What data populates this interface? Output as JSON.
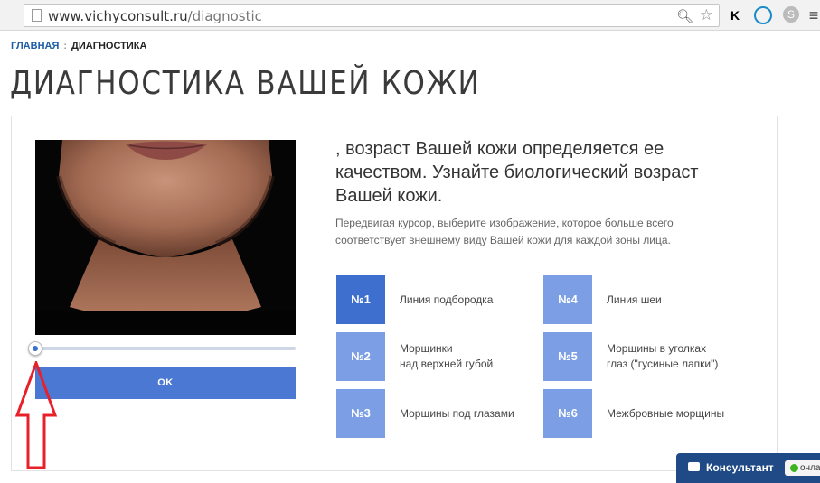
{
  "browser": {
    "url_domain": "www.vichyconsult.ru",
    "url_path": "/diagnostic",
    "extensions": [
      {
        "name": "k-extension-icon",
        "glyph": "K"
      },
      {
        "name": "a-extension-icon",
        "glyph": ""
      },
      {
        "name": "skype-icon",
        "glyph": "S"
      },
      {
        "name": "menu-icon",
        "glyph": "≡"
      }
    ]
  },
  "breadcrumb": {
    "home": "ГЛАВНАЯ",
    "separator": ":",
    "current": "ДИАГНОСТИКА"
  },
  "page_title": "ДИАГНОСТИКА ВАШЕЙ КОЖИ",
  "diagnostic": {
    "lead": ", возраст Вашей кожи определяется ее качеством. Узнайте биологический возраст Вашей кожи.",
    "instruction": "Передвигая курсор, выберите изображение, которое больше всего соответствует внешнему виду Вашей кожи для каждой зоны лица.",
    "slider_position_fraction": 0.0,
    "ok_label": "OK",
    "zones": [
      {
        "number": "№1",
        "label": "Линия подбородка",
        "active": true
      },
      {
        "number": "№2",
        "label": "Морщинки\nнад верхней губой",
        "active": false
      },
      {
        "number": "№3",
        "label": "Морщины под глазами",
        "active": false
      },
      {
        "number": "№4",
        "label": "Линия шеи",
        "active": false
      },
      {
        "number": "№5",
        "label": "Морщины в уголках\nглаз (\"гусиные лапки\")",
        "active": false
      },
      {
        "number": "№6",
        "label": "Межбровные морщины",
        "active": false
      }
    ]
  },
  "consultant": {
    "label": "Консультант",
    "status": "онлайн"
  },
  "colors": {
    "accent": "#4a78d2",
    "zone_active": "#3e6fcf",
    "zone_idle": "#7c9ee4",
    "consultant_bg": "#1f4a86",
    "annotation_arrow": "#e8202a"
  }
}
